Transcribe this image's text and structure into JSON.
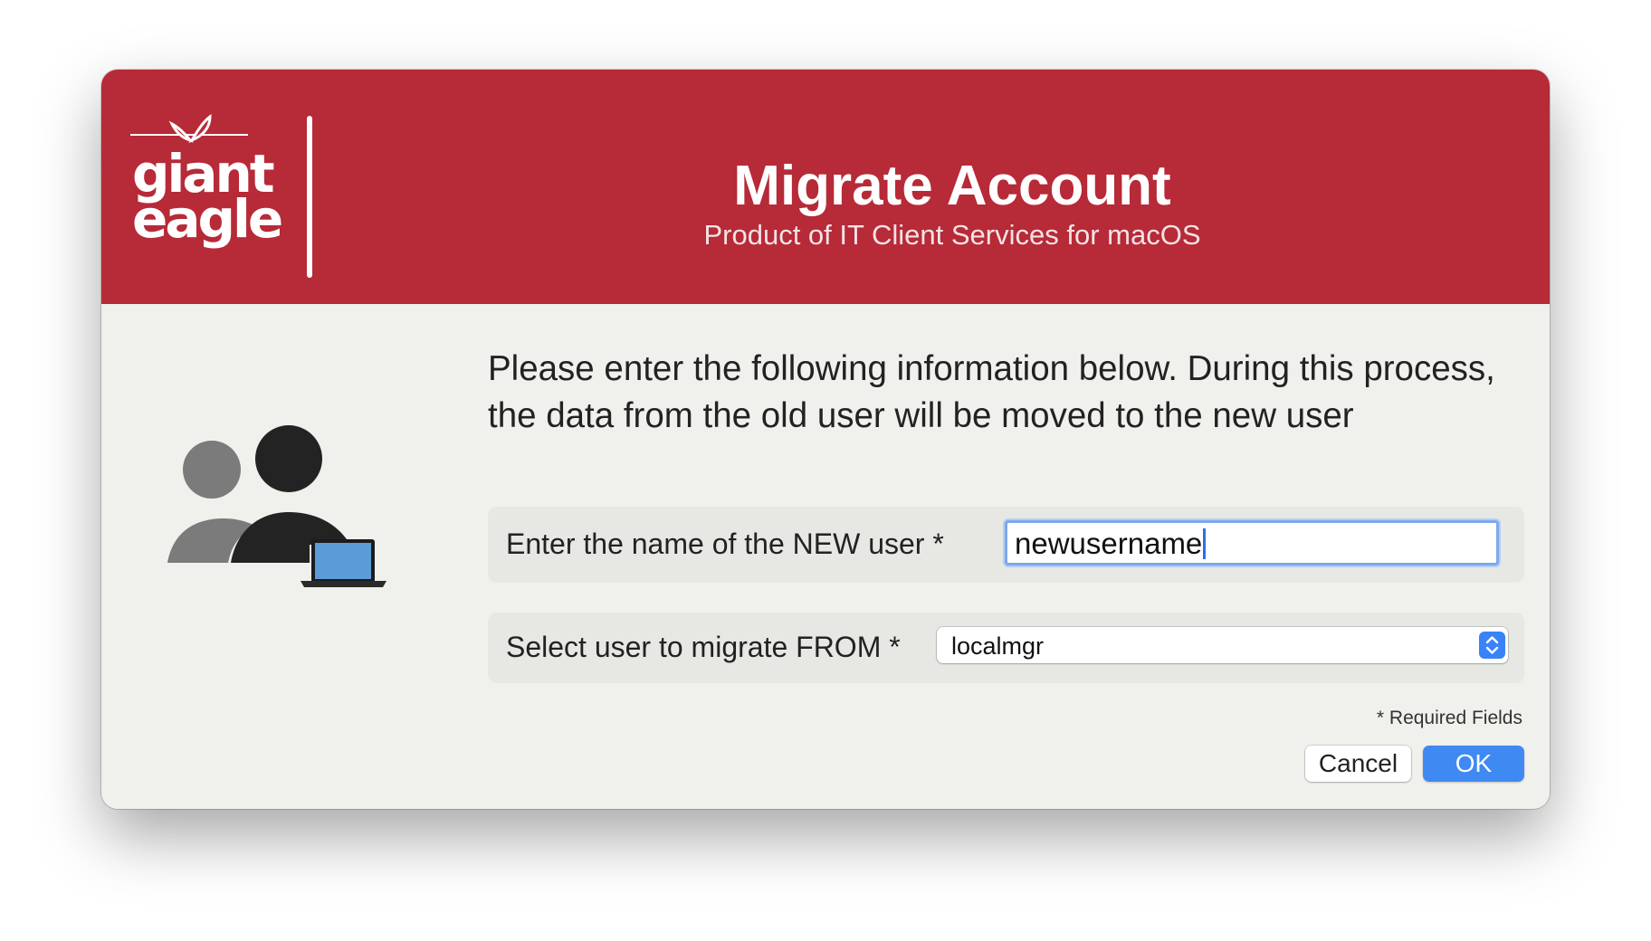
{
  "header": {
    "logo_line1": "giant",
    "logo_line2": "eagle",
    "title": "Migrate Account",
    "subtitle": "Product of IT Client Services for macOS",
    "brand_color": "#b72a37"
  },
  "body": {
    "intro": "Please enter the following information below. During this process, the data from the old user will be moved to the new user",
    "icon": "users-with-laptop-icon"
  },
  "form": {
    "new_user": {
      "label": "Enter the name of the NEW user *",
      "value": "newusername"
    },
    "migrate_from": {
      "label": "Select user to migrate FROM *",
      "selected": "localmgr"
    },
    "required_note": "* Required Fields"
  },
  "buttons": {
    "cancel": "Cancel",
    "ok": "OK",
    "accent_color": "#3f89f3"
  }
}
